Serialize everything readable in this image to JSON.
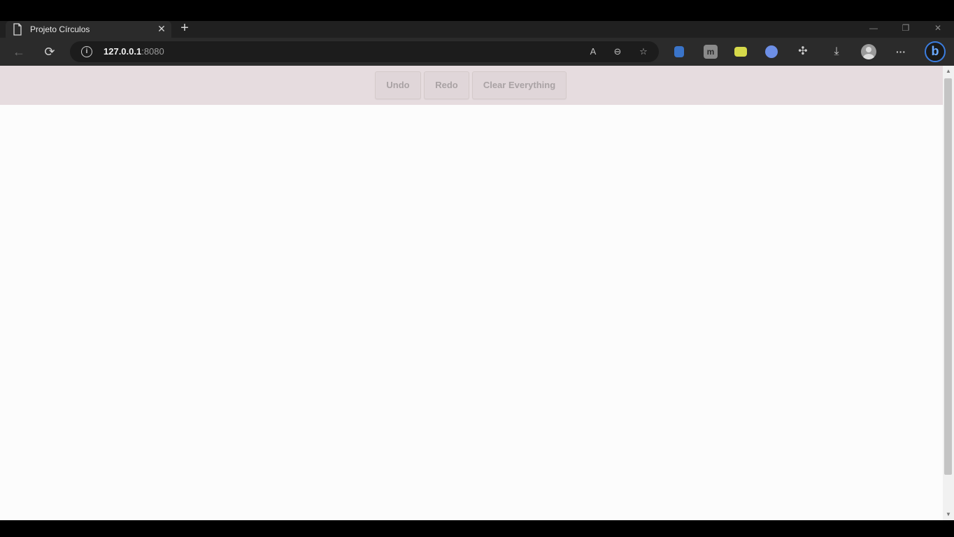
{
  "browser": {
    "tab": {
      "title": "Projeto Círculos",
      "close": "✕"
    },
    "new_tab": "+",
    "window_controls": {
      "minimize": "—",
      "restore": "❐",
      "close": "✕"
    },
    "address": {
      "host": "127.0.0.1",
      "port": ":8080"
    },
    "nav": {
      "back": "←",
      "reload": "⟳"
    },
    "icons": {
      "read_aloud": "A",
      "zoom_out": "⊖",
      "favorites": "☆",
      "downloads": "⤓",
      "more": "···",
      "extensions": "✣",
      "bing": "b"
    }
  },
  "app": {
    "toolbar": {
      "undo_label": "Undo",
      "redo_label": "Redo",
      "clear_label": "Clear Everything"
    }
  },
  "colors": {
    "header_bg": "#e6dcdf",
    "canvas_bg": "#fcfcfc",
    "button_text": "#a9a2a4"
  }
}
